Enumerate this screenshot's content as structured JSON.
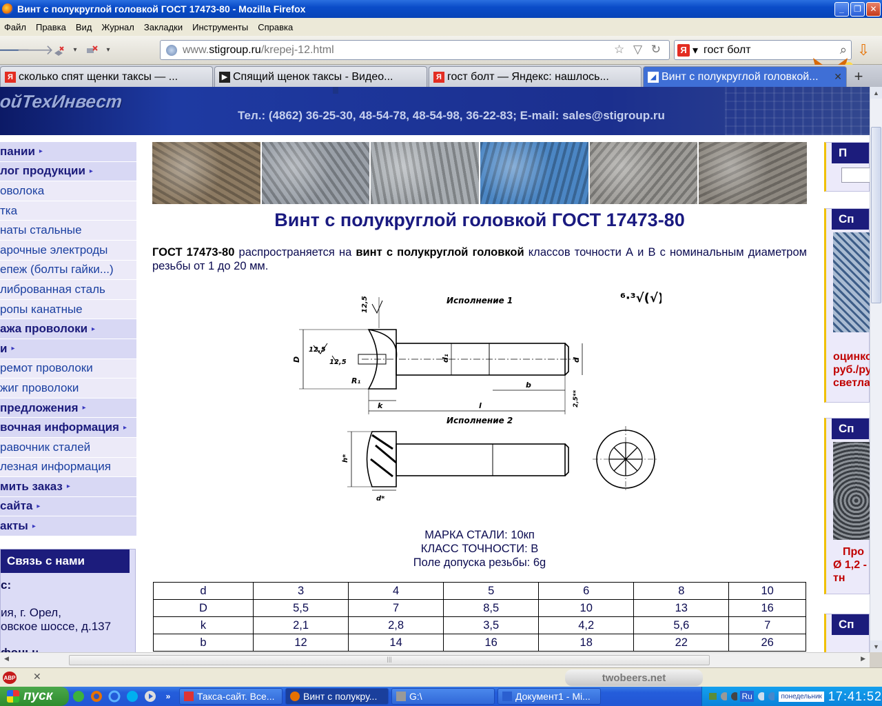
{
  "window": {
    "title": "Винт с полукруглой головкой ГОСТ 17473-80 - Mozilla Firefox",
    "minimize": "_",
    "restore": "❐",
    "close": "✕"
  },
  "menu": [
    "Файл",
    "Правка",
    "Вид",
    "Журнал",
    "Закладки",
    "Инструменты",
    "Справка"
  ],
  "nav": {
    "back_glyph": "🡐",
    "forward_glyph": "🡒",
    "url_scheme": "www.",
    "url_host": "stigroup.ru",
    "url_path": "/krepej-12.html",
    "url_icons": "☆ ▽ ↻",
    "search_engine": "Я",
    "search_dropdown": "▾",
    "search_query": "гост болт",
    "search_icon": "⌕",
    "download_icon": "⇩"
  },
  "tabs": [
    {
      "label": "сколько спят щенки таксы — ...",
      "icon": "Я",
      "icon_color": "#e32d22",
      "active": false
    },
    {
      "label": "Спящий щенок таксы - Видео...",
      "icon": "▶",
      "icon_color": "#222222",
      "active": false
    },
    {
      "label": "гост болт — Яндекс: нашлось...",
      "icon": "Я",
      "icon_color": "#e32d22",
      "active": false
    },
    {
      "label": "Винт с полукруглой головкой...",
      "icon": "◢",
      "icon_color": "#2a5fd0",
      "active": true
    }
  ],
  "newtab": "+",
  "tab_close": "✕",
  "site": {
    "logo": "ойТехИнвест",
    "contacts": "Тел.: (4862) 36-25-30, 48-54-78, 48-54-98, 36-22-83; E-mail: sales@stigroup.ru",
    "left_nav": [
      {
        "label": "пании",
        "type": "main",
        "arrow": true
      },
      {
        "label": "лог продукции",
        "type": "main",
        "arrow": true
      },
      {
        "label": "оволока",
        "type": "sub",
        "arrow": false
      },
      {
        "label": "тка",
        "type": "sub",
        "arrow": false
      },
      {
        "label": "наты стальные",
        "type": "sub",
        "arrow": false
      },
      {
        "label": "арочные электроды",
        "type": "sub",
        "arrow": false
      },
      {
        "label": "епеж (болты гайки...)",
        "type": "sub",
        "arrow": false
      },
      {
        "label": "либрованная сталь",
        "type": "sub",
        "arrow": false
      },
      {
        "label": "ропы канатные",
        "type": "sub",
        "arrow": false
      },
      {
        "label": "ажа проволоки",
        "type": "main",
        "arrow": true
      },
      {
        "label": "и",
        "type": "main",
        "arrow": true
      },
      {
        "label": "ремот проволоки",
        "type": "sub",
        "arrow": false
      },
      {
        "label": "жиг проволоки",
        "type": "sub",
        "arrow": false
      },
      {
        "label": "предложения",
        "type": "main",
        "arrow": true
      },
      {
        "label": "вочная информация",
        "type": "main",
        "arrow": true
      },
      {
        "label": "равочник сталей",
        "type": "sub",
        "arrow": false
      },
      {
        "label": "лезная информация",
        "type": "sub",
        "arrow": false
      },
      {
        "label": "мить заказ",
        "type": "main",
        "arrow": true
      },
      {
        "label": "сайта",
        "type": "main",
        "arrow": true
      },
      {
        "label": "акты",
        "type": "main",
        "arrow": true
      }
    ],
    "nav_arrow": "▸",
    "contact_box": {
      "title": "Связь с нами",
      "address_label": "с:",
      "address_lines": [
        "ия, г. Орел,",
        "овское шоссе, д.137"
      ],
      "phones_label": "фоны:"
    },
    "gallery": [
      {
        "name": "coil-rolls",
        "color": "#8c7a62"
      },
      {
        "name": "mesh",
        "color": "#9aa0a8"
      },
      {
        "name": "wire-coils",
        "color": "#a8adb2"
      },
      {
        "name": "electrodes",
        "color": "#4b86c4"
      },
      {
        "name": "bolts-nuts",
        "color": "#9e9c98"
      },
      {
        "name": "hex-bars",
        "color": "#8d8880"
      }
    ],
    "page_title": "Винт с полукруглой головкой ГОСТ 17473-80",
    "intro": {
      "b1": "ГОСТ 17473-80",
      "t1": " распространяется на ",
      "b2": "винт с полукруглой головкой",
      "t2": " классов точности А и В с номинальным диаметром резьбы от 1 до 20 мм."
    },
    "drawing_labels": {
      "version1": "Исполнение 1",
      "version2": "Исполнение 2",
      "roughness": "⁶·³√(√)",
      "dim_125a": "12,5",
      "dim_125b": "12,5",
      "dim_125c": "12,5",
      "D": "D",
      "d1": "d₁",
      "d": "d",
      "R1": "R₁",
      "k": "k",
      "l": "l",
      "b": "b",
      "z": "2,5**",
      "hx": "h*",
      "dx": "d*"
    },
    "specs": [
      "МАРКА СТАЛИ: 10кп",
      "КЛАСС ТОЧНОСТИ: В",
      "Поле допуска резьбы: 6g"
    ],
    "table": [
      [
        "d",
        "3",
        "4",
        "5",
        "6",
        "8",
        "10"
      ],
      [
        "D",
        "5,5",
        "7",
        "8,5",
        "10",
        "13",
        "16"
      ],
      [
        "k",
        "2,1",
        "2,8",
        "3,5",
        "4,2",
        "5,6",
        "7"
      ],
      [
        "b",
        "12",
        "14",
        "16",
        "18",
        "22",
        "26"
      ]
    ],
    "right_boxes": [
      {
        "head": "П",
        "text": []
      },
      {
        "head": "Сп",
        "text": [
          "оцинко",
          "руб./ру",
          "светла"
        ]
      },
      {
        "head": "Сп",
        "text": [
          "Про",
          "Ø 1,2 -",
          "тн"
        ]
      },
      {
        "head": "Сп",
        "text": []
      }
    ]
  },
  "statusbar": {
    "abp": "ABP",
    "abp_close": "✕",
    "twobeers": "twobeers.net"
  },
  "taskbar": {
    "start": "пуск",
    "quicklaunch_more": "»",
    "tasks": [
      {
        "label": "Такса-сайт. Все...",
        "icon_color": "#d33"
      },
      {
        "label": "Винт с полукру...",
        "icon_color": "#e77100",
        "active": true
      },
      {
        "label": "G:\\",
        "icon_color": "#888"
      },
      {
        "label": "Документ1 - Mi...",
        "icon_color": "#2a5fd0"
      }
    ],
    "lang": "Ru",
    "day": "понедельник",
    "time": "17:41:52"
  },
  "scroll": {
    "up": "▲",
    "down": "▼",
    "left": "◀",
    "right": "▶",
    "grip": "|||"
  }
}
